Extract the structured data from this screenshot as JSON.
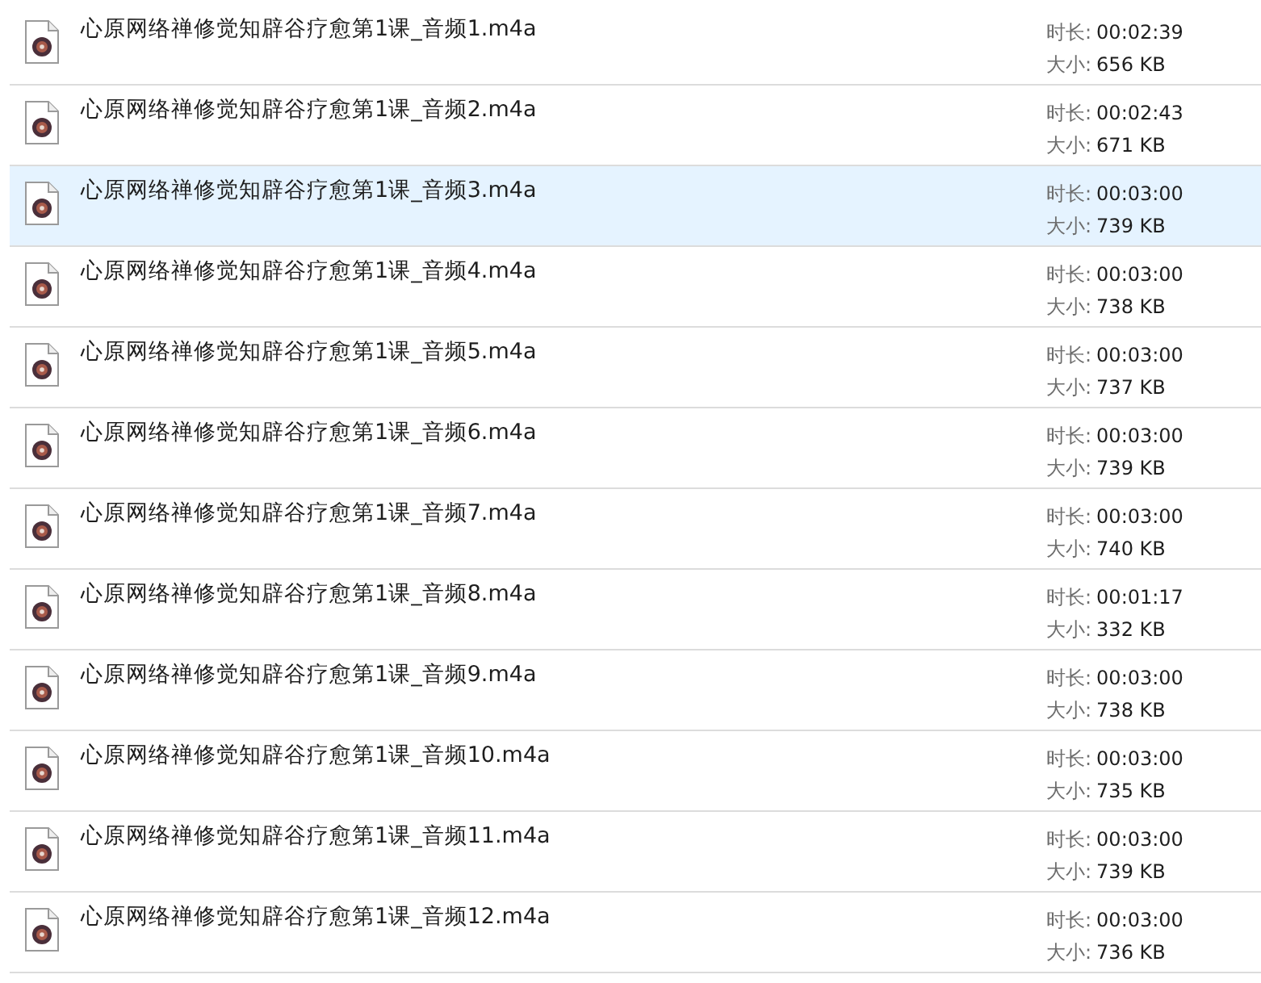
{
  "files": [
    {
      "name": "心原网络禅修觉知辟谷疗愈第1课_音频1.m4a",
      "duration_label": "时长:",
      "duration": "00:02:39",
      "size_label": "大小:",
      "size": "656 KB",
      "selected": false
    },
    {
      "name": "心原网络禅修觉知辟谷疗愈第1课_音频2.m4a",
      "duration_label": "时长:",
      "duration": "00:02:43",
      "size_label": "大小:",
      "size": "671 KB",
      "selected": false
    },
    {
      "name": "心原网络禅修觉知辟谷疗愈第1课_音频3.m4a",
      "duration_label": "时长:",
      "duration": "00:03:00",
      "size_label": "大小:",
      "size": "739 KB",
      "selected": true
    },
    {
      "name": "心原网络禅修觉知辟谷疗愈第1课_音频4.m4a",
      "duration_label": "时长:",
      "duration": "00:03:00",
      "size_label": "大小:",
      "size": "738 KB",
      "selected": false
    },
    {
      "name": "心原网络禅修觉知辟谷疗愈第1课_音频5.m4a",
      "duration_label": "时长:",
      "duration": "00:03:00",
      "size_label": "大小:",
      "size": "737 KB",
      "selected": false
    },
    {
      "name": "心原网络禅修觉知辟谷疗愈第1课_音频6.m4a",
      "duration_label": "时长:",
      "duration": "00:03:00",
      "size_label": "大小:",
      "size": "739 KB",
      "selected": false
    },
    {
      "name": "心原网络禅修觉知辟谷疗愈第1课_音频7.m4a",
      "duration_label": "时长:",
      "duration": "00:03:00",
      "size_label": "大小:",
      "size": "740 KB",
      "selected": false
    },
    {
      "name": "心原网络禅修觉知辟谷疗愈第1课_音频8.m4a",
      "duration_label": "时长:",
      "duration": "00:01:17",
      "size_label": "大小:",
      "size": "332 KB",
      "selected": false
    },
    {
      "name": "心原网络禅修觉知辟谷疗愈第1课_音频9.m4a",
      "duration_label": "时长:",
      "duration": "00:03:00",
      "size_label": "大小:",
      "size": "738 KB",
      "selected": false
    },
    {
      "name": "心原网络禅修觉知辟谷疗愈第1课_音频10.m4a",
      "duration_label": "时长:",
      "duration": "00:03:00",
      "size_label": "大小:",
      "size": "735 KB",
      "selected": false
    },
    {
      "name": "心原网络禅修觉知辟谷疗愈第1课_音频11.m4a",
      "duration_label": "时长:",
      "duration": "00:03:00",
      "size_label": "大小:",
      "size": "739 KB",
      "selected": false
    },
    {
      "name": "心原网络禅修觉知辟谷疗愈第1课_音频12.m4a",
      "duration_label": "时长:",
      "duration": "00:03:00",
      "size_label": "大小:",
      "size": "736 KB",
      "selected": false
    }
  ]
}
